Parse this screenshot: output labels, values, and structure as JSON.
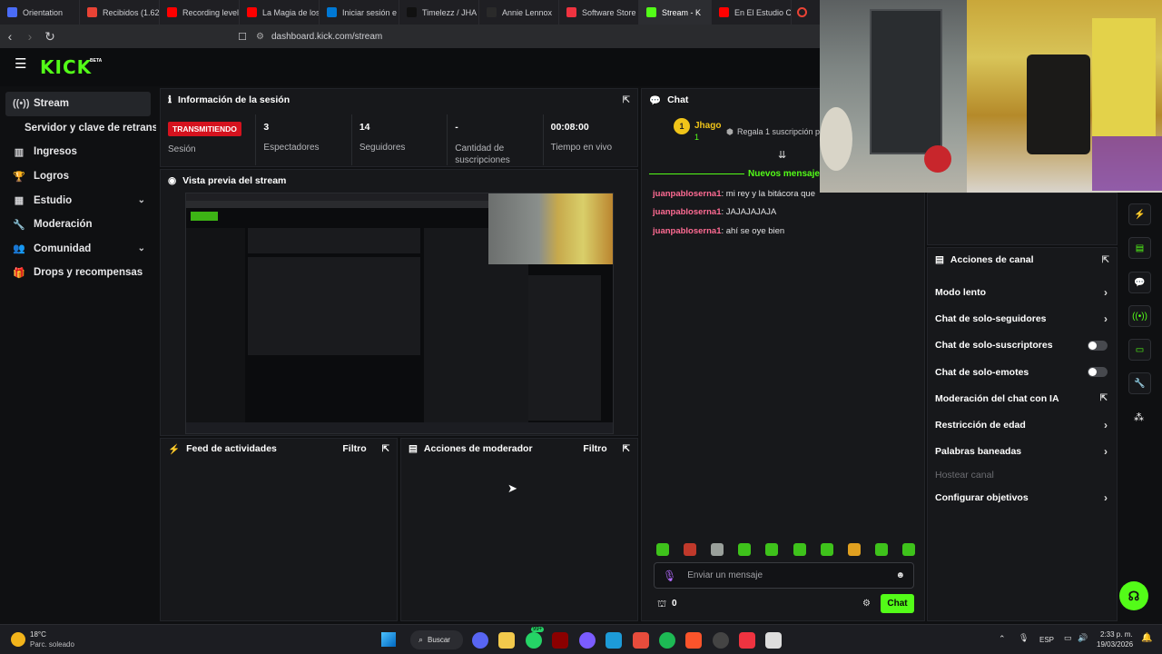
{
  "browser": {
    "tabs": [
      {
        "label": "Orientation",
        "color": "#4a6cf7"
      },
      {
        "label": "Recibidos (1.62",
        "color": "#e94335"
      },
      {
        "label": "Recording level",
        "color": "#ff0000"
      },
      {
        "label": "La Magia de los",
        "color": "#ff0000"
      },
      {
        "label": "Iniciar sesión e",
        "color": "#0078d4"
      },
      {
        "label": "Timelezz / JHA",
        "color": "#111111"
      },
      {
        "label": "Annie Lennox",
        "color": "#2a2a2a"
      },
      {
        "label": "Software Store",
        "color": "#ef3340"
      },
      {
        "label": "Stream - K",
        "color": "#53fc18",
        "active": true
      },
      {
        "label": "En El Estudio C",
        "color": "#ff0000"
      }
    ],
    "url": "dashboard.kick.com/stream"
  },
  "header": {
    "logo": "KICK",
    "beta": "BETA"
  },
  "sidebar": {
    "items": [
      {
        "label": "Stream",
        "icon": "broadcast-icon",
        "glyph": "((•))"
      },
      {
        "label": "Servidor y clave de retransmisión",
        "icon": "",
        "glyph": ""
      },
      {
        "label": "Ingresos",
        "icon": "chart-icon",
        "glyph": "▥"
      },
      {
        "label": "Logros",
        "icon": "trophy-icon",
        "glyph": "🏆"
      },
      {
        "label": "Estudio",
        "icon": "grid-icon",
        "glyph": "▦"
      },
      {
        "label": "Moderación",
        "icon": "wrench-icon",
        "glyph": "🔧"
      },
      {
        "label": "Comunidad",
        "icon": "people-icon",
        "glyph": "👥"
      },
      {
        "label": "Drops y recompensas",
        "icon": "gift-icon",
        "glyph": "🎁"
      }
    ]
  },
  "session": {
    "title": "Información de la sesión",
    "badge": "TRANSMITIENDO",
    "stats": [
      {
        "label": "Sesión",
        "value": ""
      },
      {
        "label": "Espectadores",
        "value": "3"
      },
      {
        "label": "Seguidores",
        "value": "14"
      },
      {
        "label": "Cantidad de suscripciones",
        "value": "-"
      },
      {
        "label": "Tiempo en vivo",
        "value": "00:08:00"
      }
    ]
  },
  "preview": {
    "title": "Vista previa del stream"
  },
  "activity": {
    "title": "Feed de actividades",
    "filter": "Filtro"
  },
  "modactions": {
    "title": "Acciones de moderador",
    "filter": "Filtro"
  },
  "chat": {
    "title": "Chat",
    "pinned_user": "Jhago",
    "pinned_level": "1",
    "pinned_text": "Regala 1 suscripción pa",
    "new_messages": "Nuevos mensajes",
    "messages": [
      {
        "user": "juanpabloserna1",
        "text": ": mi rey y la bitácora que"
      },
      {
        "user": "juanpabloserna1",
        "text": ": JAJAJAJAJA"
      },
      {
        "user": "juanpabloserna1",
        "text": ": ahí se oye bien"
      }
    ],
    "input_placeholder": "Enviar un mensaje",
    "points": "0",
    "send_label": "Chat"
  },
  "channel_actions": {
    "title": "Acciones de canal",
    "items": [
      {
        "label": "Modo lento",
        "control": "arrow"
      },
      {
        "label": "Chat de solo-seguidores",
        "control": "arrow"
      },
      {
        "label": "Chat de solo-suscriptores",
        "control": "toggle"
      },
      {
        "label": "Chat de solo-emotes",
        "control": "toggle"
      },
      {
        "label": "Moderación del chat con IA",
        "control": "external"
      },
      {
        "label": "Restricción de edad",
        "control": "arrow"
      },
      {
        "label": "Palabras baneadas",
        "control": "arrow"
      },
      {
        "label": "Hostear canal",
        "control": "disabled"
      },
      {
        "label": "Configurar objetivos",
        "control": "arrow"
      }
    ]
  },
  "taskbar": {
    "weather_temp": "18°C",
    "weather_desc": "Parc. soleado",
    "search_label": "Buscar",
    "badge": "99+",
    "lang": "ESP",
    "time": "2:33 p. m.",
    "date": "19/03/2026"
  },
  "colors": {
    "accent": "#53fc18",
    "live": "#d5121e",
    "username": "#ff6b93"
  }
}
